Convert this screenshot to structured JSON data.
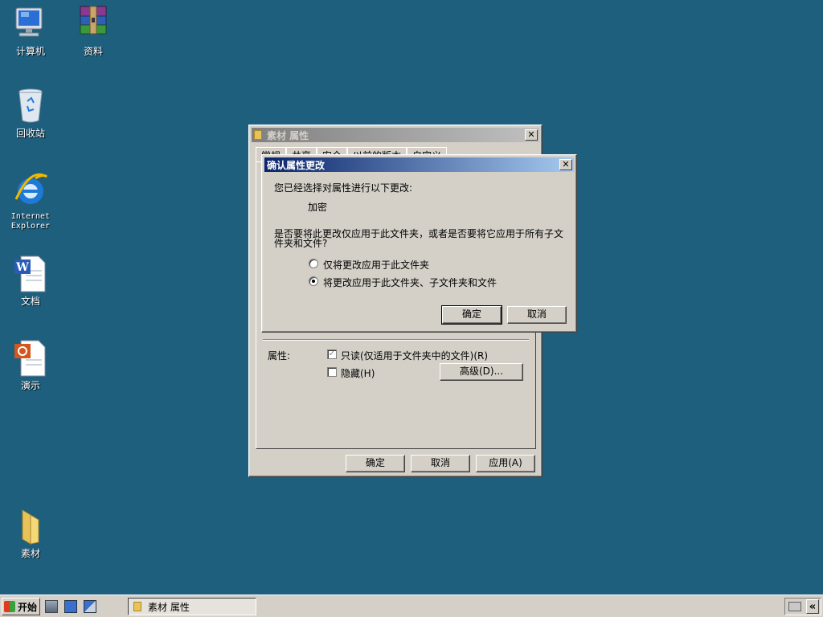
{
  "desktop": {
    "icons": [
      {
        "label": "计算机",
        "icon": "computer-icon"
      },
      {
        "label": "资料",
        "icon": "winrar-archive-icon"
      },
      {
        "label": "回收站",
        "icon": "recycle-bin-icon"
      },
      {
        "label": "Internet\nExplorer",
        "icon": "internet-explorer-icon"
      },
      {
        "label": "文档",
        "icon": "word-document-icon"
      },
      {
        "label": "演示",
        "icon": "powerpoint-document-icon"
      },
      {
        "label": "素材",
        "icon": "folder-icon"
      }
    ]
  },
  "properties_window": {
    "title": "素材 属性",
    "tabs": [
      "常规",
      "共享",
      "安全",
      "以前的版本",
      "自定义"
    ],
    "attributes_label": "属性:",
    "readonly_label": "只读(仅适用于文件夹中的文件)(R)",
    "readonly_checked": true,
    "hidden_label": "隐藏(H)",
    "hidden_checked": false,
    "advanced_button": "高级(D)...",
    "ok_button": "确定",
    "cancel_button": "取消",
    "apply_button": "应用(A)"
  },
  "confirm_dialog": {
    "title": "确认属性更改",
    "intro": "您已经选择对属性进行以下更改:",
    "change": "加密",
    "question": "是否要将此更改仅应用于此文件夹，或者是否要将它应用于所有子文件夹和文件?",
    "option_folder_only": "仅将更改应用于此文件夹",
    "option_all": "将更改应用于此文件夹、子文件夹和文件",
    "selected_option": "option_all",
    "ok_button": "确定",
    "cancel_button": "取消"
  },
  "taskbar": {
    "start_label": "开始",
    "task_label": "素材 属性",
    "tray_chevron": "«"
  },
  "colors": {
    "desktop": "#1e5f7e",
    "active_title_start": "#0a246a",
    "active_title_end": "#a6caf0",
    "window_face": "#d4d0c8"
  }
}
